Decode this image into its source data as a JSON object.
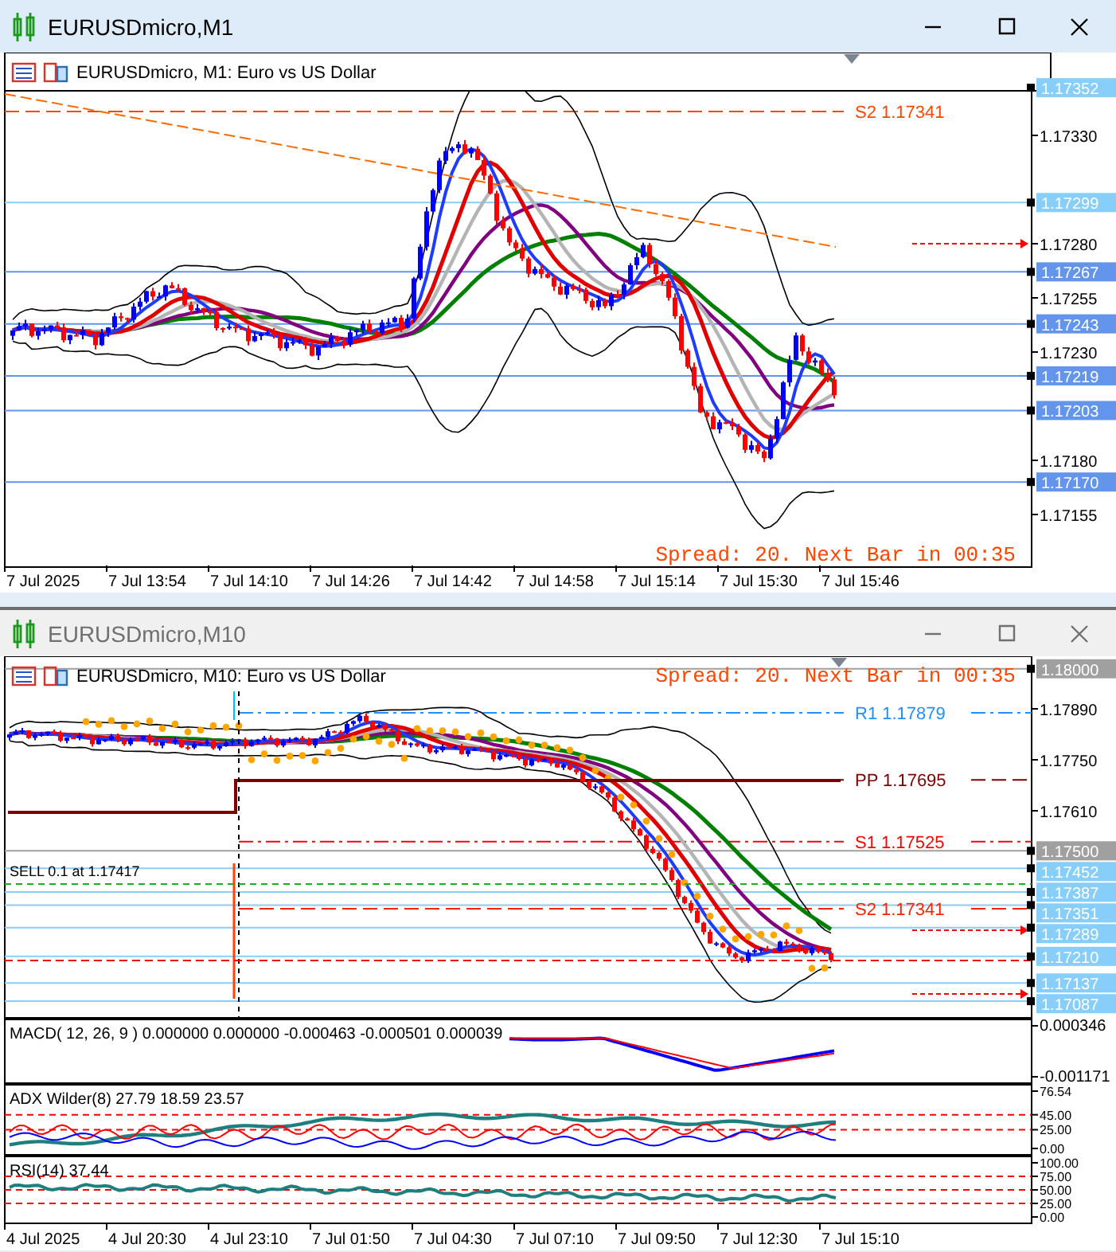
{
  "windows": [
    {
      "title": "EURUSDmicro,M1",
      "active": true,
      "chart": {
        "header": "EURUSDmicro, M1:  Euro vs US Dollar",
        "spread": "Spread: 20. Next Bar in 00:35",
        "price_ticks": [
          "1.17330",
          "1.17280",
          "1.17255",
          "1.17230",
          "1.17180",
          "1.17155"
        ],
        "price_tags": [
          {
            "label": "1.17352",
            "color": "#87cefa"
          },
          {
            "label": "1.17299",
            "color": "#87cefa"
          },
          {
            "label": "1.17267",
            "color": "#6495ed"
          },
          {
            "label": "1.17243",
            "color": "#6495ed"
          },
          {
            "label": "1.17219",
            "color": "#6495ed"
          },
          {
            "label": "1.17203",
            "color": "#6495ed"
          },
          {
            "label": "1.17170",
            "color": "#6495ed"
          }
        ],
        "pivots": [
          {
            "label": "S2 1.17341",
            "color": "#ff4500"
          }
        ],
        "time_labels": [
          "7 Jul 2025",
          "7 Jul 13:54",
          "7 Jul 14:10",
          "7 Jul 14:26",
          "7 Jul 14:42",
          "7 Jul 14:58",
          "7 Jul 15:14",
          "7 Jul 15:30",
          "7 Jul 15:46"
        ]
      }
    },
    {
      "title": "EURUSDmicro,M10",
      "active": false,
      "chart": {
        "header": "EURUSDmicro, M10:  Euro vs US Dollar",
        "spread": "Spread: 20. Next Bar in 00:35",
        "price_ticks": [
          "1.17890",
          "1.17750",
          "1.17610"
        ],
        "price_tags": [
          {
            "label": "1.18000",
            "color": "#a0a0a0"
          },
          {
            "label": "1.17500",
            "color": "#a0a0a0"
          },
          {
            "label": "1.17452",
            "color": "#87cefa"
          },
          {
            "label": "1.17387",
            "color": "#87cefa"
          },
          {
            "label": "1.17351",
            "color": "#87cefa"
          },
          {
            "label": "1.17289",
            "color": "#87cefa"
          },
          {
            "label": "1.17210",
            "color": "#87cefa"
          },
          {
            "label": "1.17137",
            "color": "#87cefa"
          },
          {
            "label": "1.17087",
            "color": "#87cefa"
          }
        ],
        "pivots": [
          {
            "label": "R1 1.17879",
            "color": "#1e90ff"
          },
          {
            "label": "PP 1.17695",
            "color": "#800000"
          },
          {
            "label": "S1 1.17525",
            "color": "#ff0000"
          },
          {
            "label": "S2 1.17341",
            "color": "#ff2200"
          }
        ],
        "orders": [
          {
            "label": "SELL 0.1 at 1.17417"
          }
        ],
        "panes": [
          {
            "kind": "macd",
            "label": "MACD( 12, 26, 9 ) 0.000000 0.000000 -0.000463 -0.000501 0.000039",
            "ticks": [
              "0.000346",
              "-0.001171"
            ]
          },
          {
            "kind": "adx",
            "label": "ADX Wilder(8) 27.79 18.59 23.57",
            "ticks": [
              "76.54",
              "45.00",
              "25.00",
              "0.00"
            ]
          },
          {
            "kind": "rsi",
            "label": "RSI(14) 37.44",
            "ticks": [
              "100.00",
              "75.00",
              "50.00",
              "25.00",
              "0.00"
            ]
          }
        ],
        "time_labels": [
          "4 Jul 2025",
          "4 Jul 20:30",
          "4 Jul 23:10",
          "7 Jul 01:50",
          "7 Jul 04:30",
          "7 Jul 07:10",
          "7 Jul 09:50",
          "7 Jul 12:30",
          "7 Jul 15:10"
        ]
      }
    }
  ]
}
